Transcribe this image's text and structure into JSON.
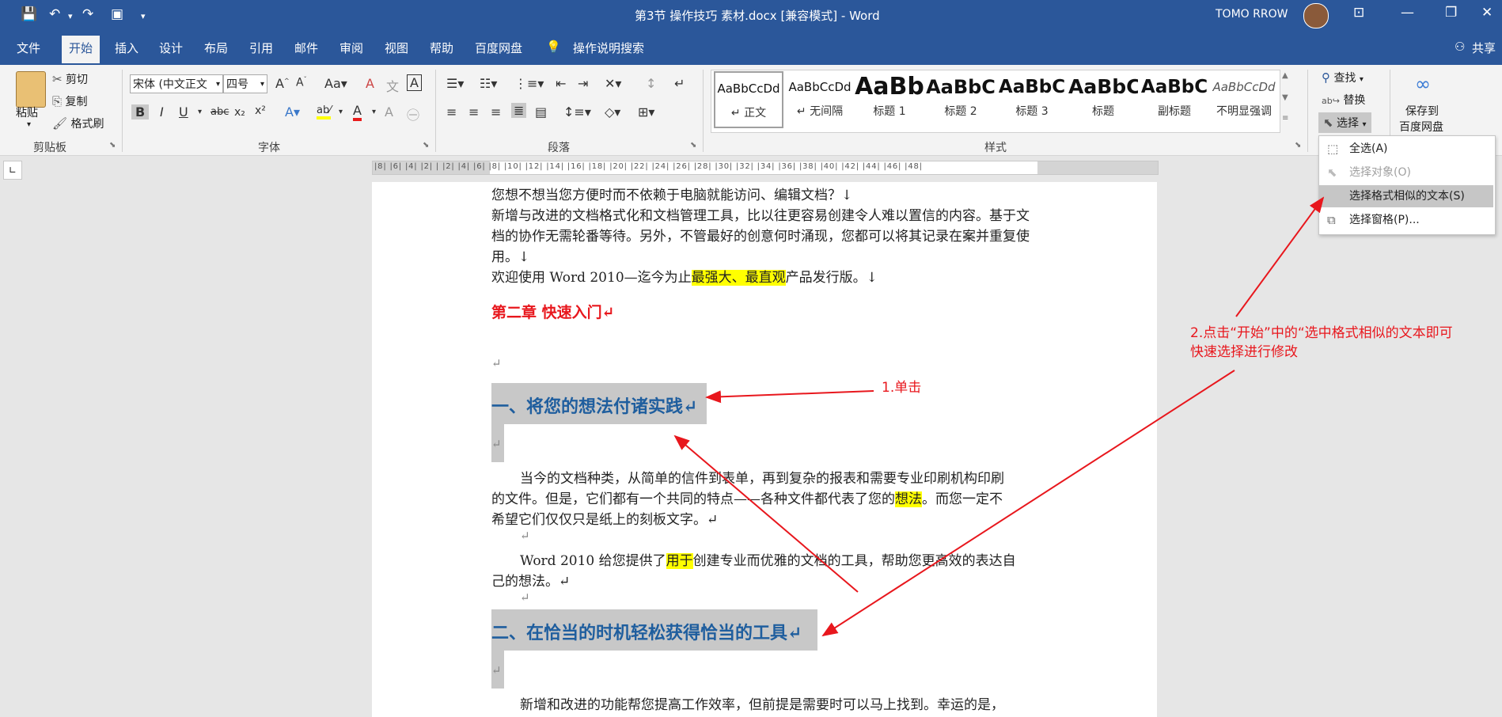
{
  "window": {
    "title": "第3节 操作技巧 素材.docx [兼容模式] - Word",
    "user": "TOMO RROW"
  },
  "tabs": [
    "文件",
    "开始",
    "插入",
    "设计",
    "布局",
    "引用",
    "邮件",
    "审阅",
    "视图",
    "帮助",
    "百度网盘"
  ],
  "tell_me": "操作说明搜索",
  "share": "共享",
  "clipboard": {
    "paste": "粘贴",
    "cut": "剪切",
    "copy": "复制",
    "painter": "格式刷",
    "label": "剪贴板"
  },
  "font": {
    "name": "宋体 (中文正文",
    "size": "四号",
    "label": "字体"
  },
  "paragraph": {
    "label": "段落"
  },
  "styles": {
    "label": "样式",
    "items": [
      {
        "preview": "AaBbCcDd",
        "name": "↵ 正文"
      },
      {
        "preview": "AaBbCcDd",
        "name": "↵ 无间隔"
      },
      {
        "preview": "AaBb",
        "name": "标题 1"
      },
      {
        "preview": "AaBbC",
        "name": "标题 2"
      },
      {
        "preview": "AaBbC",
        "name": "标题 3"
      },
      {
        "preview": "AaBbC",
        "name": "标题"
      },
      {
        "preview": "AaBbC",
        "name": "副标题"
      },
      {
        "preview": "AaBbCcDd",
        "name": "不明显强调"
      }
    ]
  },
  "editing": {
    "find": "查找",
    "replace": "替换",
    "select": "选择"
  },
  "baidu": {
    "line1": "保存到",
    "line2": "百度网盘"
  },
  "dropdown": {
    "items": [
      {
        "label": "全选(A)",
        "state": "enabled"
      },
      {
        "label": "选择对象(O)",
        "state": "disabled"
      },
      {
        "label": "选择格式相似的文本(S)",
        "state": "highlighted"
      },
      {
        "label": "选择窗格(P)...",
        "state": "enabled"
      }
    ]
  },
  "ruler_text": "|8| |6| |4| |2| | |2| |4| |6| |8| |10| |12| |14| |16| |18| |20| |22| |24| |26| |28| |30| |32| |34| |36| |38| |40| |42| |44| |46| |48|",
  "document": {
    "lines": {
      "l1": "您想不想当您方便时而不依赖于电脑就能访问、编辑文档？↓",
      "l2": "新增与改进的文档格式化和文档管理工具，比以往更容易创建令人难以置信的内容。基于文",
      "l3": "档的协作无需轮番等待。另外，不管最好的创意何时涌现，您都可以将其记录在案并重复使",
      "l4": "用。↓",
      "l5a": "欢迎使用 Word 2010—迄今为止",
      "l5b": "最强大、最直观",
      "l5c": "产品发行版。↓",
      "chapter": "第二章  快速入门↵",
      "empty": "↵",
      "h1": "一、将您的想法付诸实践↵",
      "p1a": "当今的文档种类，从简单的信件到表单，再到复杂的报表和需要专业印刷机构印刷",
      "p1b1": "的文件。但是，它们都有一个共同的特点——各种文件都代表了您的",
      "p1b2": "想法",
      "p1b3": "。而您一定不",
      "p1c": "希望它们仅仅只是纸上的刻板文字。↵",
      "p2a1": "Word 2010 给您提供了",
      "p2a2": "用于",
      "p2a3": "创建专业而优雅的文档的工具，帮助您更高效的表达自",
      "p2b": "己的想法。↵",
      "h2": "二、在恰当的时机轻松获得恰当的工具↵",
      "p3": "新增和改进的功能帮您提高工作效率，但前提是需要时可以马上找到。幸运的是，"
    }
  },
  "annotations": {
    "a1": "1.单击",
    "a2_line1": "2.点击“开始”中的“选中格式相似的文本即可",
    "a2_line2": "快速选择进行修改"
  },
  "colors": {
    "accent": "#2b579a",
    "annotation": "#e8171d",
    "highlight": "#ffff00",
    "heading": "#1f5e9e",
    "chapter": "#e8171d"
  }
}
